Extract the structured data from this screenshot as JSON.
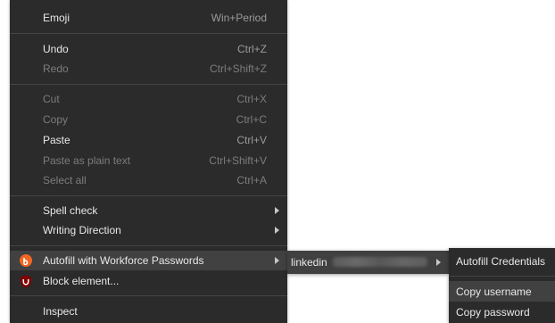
{
  "main_menu": {
    "items": [
      {
        "label": "Emoji",
        "shortcut": "Win+Period"
      },
      {
        "label": "Undo",
        "shortcut": "Ctrl+Z"
      },
      {
        "label": "Redo",
        "shortcut": "Ctrl+Shift+Z"
      },
      {
        "label": "Cut",
        "shortcut": "Ctrl+X"
      },
      {
        "label": "Copy",
        "shortcut": "Ctrl+C"
      },
      {
        "label": "Paste",
        "shortcut": "Ctrl+V"
      },
      {
        "label": "Paste as plain text",
        "shortcut": "Ctrl+Shift+V"
      },
      {
        "label": "Select all",
        "shortcut": "Ctrl+A"
      },
      {
        "label": "Spell check"
      },
      {
        "label": "Writing Direction"
      },
      {
        "label": "Autofill with Workforce Passwords",
        "icon": "workforce-passwords-icon",
        "icon_color": "#f26522"
      },
      {
        "label": "Block element...",
        "icon": "ublock-shield-icon",
        "icon_color": "#800000"
      },
      {
        "label": "Inspect"
      }
    ]
  },
  "account_submenu": {
    "items": [
      {
        "label": "linkedin"
      }
    ]
  },
  "credentials_submenu": {
    "items": [
      {
        "label": "Autofill Credentials"
      },
      {
        "label": "Copy username"
      },
      {
        "label": "Copy password"
      }
    ]
  }
}
